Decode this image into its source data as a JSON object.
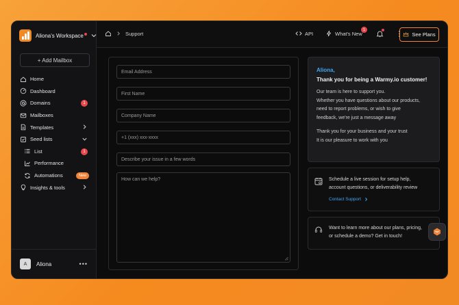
{
  "workspace": {
    "name": "Aliona's Workspace"
  },
  "sidebar": {
    "add_mailbox": "+ Add Mailbox",
    "items": [
      {
        "label": "Home",
        "icon": "home-icon"
      },
      {
        "label": "Dashboard",
        "icon": "dashboard-icon"
      },
      {
        "label": "Domains",
        "icon": "at-icon",
        "badge": "1"
      },
      {
        "label": "Mailboxes",
        "icon": "mail-icon"
      },
      {
        "label": "Templates",
        "icon": "document-icon"
      },
      {
        "label": "Seed lists",
        "icon": "seed-list-icon"
      },
      {
        "label": "List",
        "icon": "list-icon",
        "badge": "1"
      },
      {
        "label": "Performance",
        "icon": "chart-icon"
      },
      {
        "label": "Automations",
        "icon": "refresh-icon",
        "badge": "New"
      },
      {
        "label": "Insights & tools",
        "icon": "lightbulb-icon"
      }
    ],
    "profile": {
      "initial": "A",
      "name": "Aliona"
    }
  },
  "topbar": {
    "breadcrumb": "Support",
    "api": "API",
    "whats_new": "What's New",
    "whats_new_badge": "1",
    "see_plans": "See Plans"
  },
  "form": {
    "email_placeholder": "Email Address",
    "first_name_placeholder": "First Name",
    "company_placeholder": "Company Name",
    "phone_placeholder": "+1 (xxx) xxx-xxxx",
    "issue_placeholder": "Describe your issue in a few words",
    "message_placeholder": "How can we help?"
  },
  "info": {
    "greeting": "Aliona,",
    "thanks": "Thank you for being a Warmy.io customer!",
    "lines1": [
      "Our team is here to support you.",
      "Whether you have questions about our products,",
      "need to report problems, or wish to give",
      "feedback, we're just a message away"
    ],
    "lines2": [
      "Thank you for your business and your trust",
      "It is our pleasure to work with you"
    ]
  },
  "schedule": {
    "lines": [
      "Schedule a live session for setup help,",
      "account questions, or deliverability review"
    ],
    "link": "Contact Support"
  },
  "demo": {
    "lines": [
      "Want to learn more about our plans, pricing,",
      "or schedule a demo? Get in touch!"
    ]
  },
  "colors": {
    "accent": "#f0843a",
    "link": "#3fa7f5",
    "badge": "#e5484d",
    "background": "#0c0c0d"
  }
}
